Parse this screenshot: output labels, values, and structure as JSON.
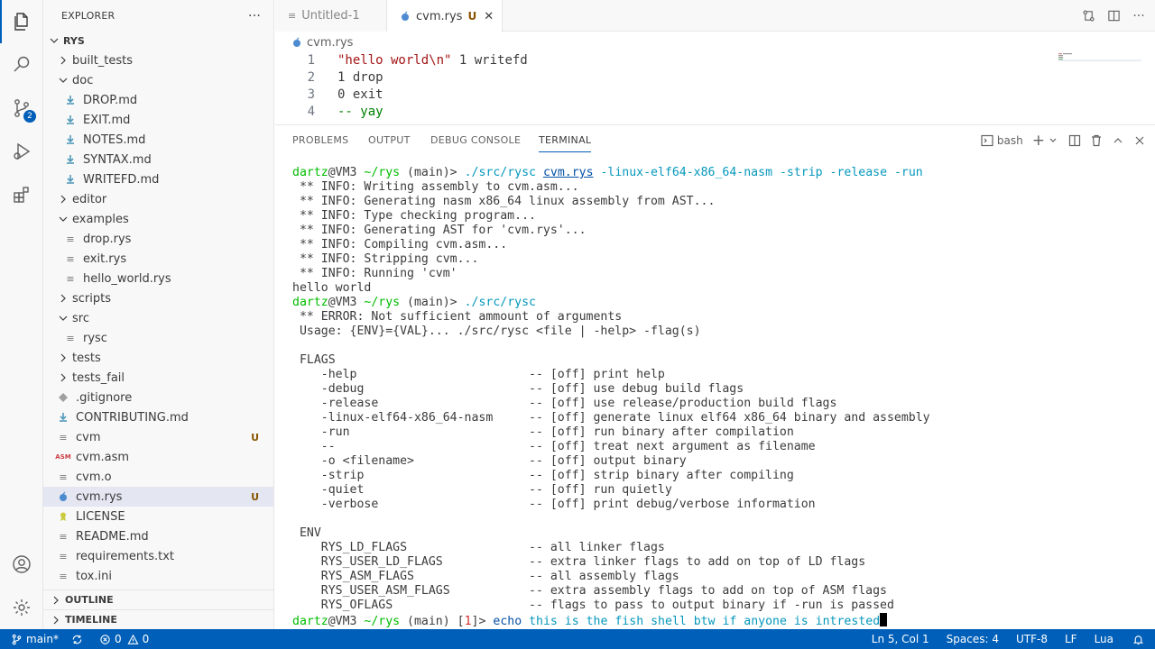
{
  "explorer": {
    "title": "EXPLORER",
    "more": "···",
    "root": "RYS",
    "items": [
      {
        "label": "built_tests",
        "kind": "folder-closed",
        "depth": 1
      },
      {
        "label": "doc",
        "kind": "folder-open",
        "depth": 1
      },
      {
        "label": "DROP.md",
        "kind": "md",
        "depth": 2
      },
      {
        "label": "EXIT.md",
        "kind": "md",
        "depth": 2
      },
      {
        "label": "NOTES.md",
        "kind": "md",
        "depth": 2
      },
      {
        "label": "SYNTAX.md",
        "kind": "md",
        "depth": 2
      },
      {
        "label": "WRITEFD.md",
        "kind": "md",
        "depth": 2
      },
      {
        "label": "editor",
        "kind": "folder-closed",
        "depth": 1
      },
      {
        "label": "examples",
        "kind": "folder-open",
        "depth": 1
      },
      {
        "label": "drop.rys",
        "kind": "file",
        "depth": 2
      },
      {
        "label": "exit.rys",
        "kind": "file",
        "depth": 2
      },
      {
        "label": "hello_world.rys",
        "kind": "file",
        "depth": 2
      },
      {
        "label": "scripts",
        "kind": "folder-closed",
        "depth": 1
      },
      {
        "label": "src",
        "kind": "folder-open",
        "depth": 1
      },
      {
        "label": "rysc",
        "kind": "file",
        "depth": 2
      },
      {
        "label": "tests",
        "kind": "folder-closed",
        "depth": 1
      },
      {
        "label": "tests_fail",
        "kind": "folder-closed",
        "depth": 1
      },
      {
        "label": ".gitignore",
        "kind": "git",
        "depth": 1
      },
      {
        "label": "CONTRIBUTING.md",
        "kind": "md",
        "depth": 1
      },
      {
        "label": "cvm",
        "kind": "file",
        "depth": 1,
        "status": "U"
      },
      {
        "label": "cvm.asm",
        "kind": "asm",
        "depth": 1
      },
      {
        "label": "cvm.o",
        "kind": "file",
        "depth": 1
      },
      {
        "label": "cvm.rys",
        "kind": "rys",
        "depth": 1,
        "status": "U",
        "selected": true
      },
      {
        "label": "LICENSE",
        "kind": "license",
        "depth": 1
      },
      {
        "label": "README.md",
        "kind": "file",
        "depth": 1
      },
      {
        "label": "requirements.txt",
        "kind": "file",
        "depth": 1
      },
      {
        "label": "tox.ini",
        "kind": "file",
        "depth": 1
      }
    ],
    "outline": "OUTLINE",
    "timeline": "TIMELINE"
  },
  "activity": {
    "source_control_badge": "2"
  },
  "tabs": [
    {
      "label": "Untitled-1",
      "active": false
    },
    {
      "label": "cvm.rys",
      "active": true,
      "status": "U",
      "close": "✕"
    }
  ],
  "editor": {
    "breadcrumb": "cvm.rys",
    "lines": [
      {
        "n": "1",
        "tokens": [
          {
            "t": "\"hello world\\n\"",
            "c": "str"
          },
          {
            "t": " 1 writefd",
            "c": "plain"
          }
        ]
      },
      {
        "n": "2",
        "tokens": [
          {
            "t": "1 drop",
            "c": "plain"
          }
        ]
      },
      {
        "n": "3",
        "tokens": [
          {
            "t": "0 exit",
            "c": "plain"
          }
        ]
      },
      {
        "n": "4",
        "tokens": [
          {
            "t": "-- yay",
            "c": "com"
          }
        ]
      }
    ]
  },
  "panel": {
    "tabs": [
      "PROBLEMS",
      "OUTPUT",
      "DEBUG CONSOLE",
      "TERMINAL"
    ],
    "active_tab": "TERMINAL",
    "shell": "bash",
    "plus": "+"
  },
  "terminal": {
    "lines": [
      [
        {
          "t": "dartz",
          "c": "green"
        },
        {
          "t": "@VM3 ",
          "c": "grey"
        },
        {
          "t": "~/rys",
          "c": "green"
        },
        {
          "t": " (main)> ",
          "c": "grey"
        },
        {
          "t": "./src/rysc",
          "c": "cyan"
        },
        {
          "t": " ",
          "c": "grey"
        },
        {
          "t": "cvm.rys",
          "c": "link"
        },
        {
          "t": " -linux-elf64-x86_64-nasm -strip -release -run",
          "c": "cyan"
        }
      ],
      [
        {
          "t": " ** INFO: Writing assembly to cvm.asm...",
          "c": "grey"
        }
      ],
      [
        {
          "t": " ** INFO: Generating nasm x86_64 linux assembly from AST...",
          "c": "grey"
        }
      ],
      [
        {
          "t": " ** INFO: Type checking program...",
          "c": "grey"
        }
      ],
      [
        {
          "t": " ** INFO: Generating AST for 'cvm.rys'...",
          "c": "grey"
        }
      ],
      [
        {
          "t": " ** INFO: Compiling cvm.asm...",
          "c": "grey"
        }
      ],
      [
        {
          "t": " ** INFO: Stripping cvm...",
          "c": "grey"
        }
      ],
      [
        {
          "t": " ** INFO: Running 'cvm'",
          "c": "grey"
        }
      ],
      [
        {
          "t": "hello world",
          "c": "grey"
        }
      ],
      [
        {
          "t": "dartz",
          "c": "green"
        },
        {
          "t": "@VM3 ",
          "c": "grey"
        },
        {
          "t": "~/rys",
          "c": "green"
        },
        {
          "t": " (main)> ",
          "c": "grey"
        },
        {
          "t": "./src/rysc",
          "c": "cyan"
        }
      ],
      [
        {
          "t": " ** ERROR: Not sufficient ammount of arguments",
          "c": "grey"
        }
      ],
      [
        {
          "t": " Usage: {ENV}={VAL}... ./src/rysc <file | -help> -flag(s)",
          "c": "grey"
        }
      ],
      [
        {
          "t": "",
          "c": "grey"
        }
      ],
      [
        {
          "t": " FLAGS",
          "c": "grey"
        }
      ],
      [
        {
          "t": "    -help                        -- [off] print help",
          "c": "grey"
        }
      ],
      [
        {
          "t": "    -debug                       -- [off] use debug build flags",
          "c": "grey"
        }
      ],
      [
        {
          "t": "    -release                     -- [off] use release/production build flags",
          "c": "grey"
        }
      ],
      [
        {
          "t": "    -linux-elf64-x86_64-nasm     -- [off] generate linux elf64 x86_64 binary and assembly",
          "c": "grey"
        }
      ],
      [
        {
          "t": "    -run                         -- [off] run binary after compilation",
          "c": "grey"
        }
      ],
      [
        {
          "t": "    --                           -- [off] treat next argument as filename",
          "c": "grey"
        }
      ],
      [
        {
          "t": "    -o <filename>                -- [off] output binary",
          "c": "grey"
        }
      ],
      [
        {
          "t": "    -strip                       -- [off] strip binary after compiling",
          "c": "grey"
        }
      ],
      [
        {
          "t": "    -quiet                       -- [off] run quietly",
          "c": "grey"
        }
      ],
      [
        {
          "t": "    -verbose                     -- [off] print debug/verbose information",
          "c": "grey"
        }
      ],
      [
        {
          "t": "",
          "c": "grey"
        }
      ],
      [
        {
          "t": " ENV",
          "c": "grey"
        }
      ],
      [
        {
          "t": "    RYS_LD_FLAGS                 -- all linker flags",
          "c": "grey"
        }
      ],
      [
        {
          "t": "    RYS_USER_LD_FLAGS            -- extra linker flags to add on top of LD flags",
          "c": "grey"
        }
      ],
      [
        {
          "t": "    RYS_ASM_FLAGS                -- all assembly flags",
          "c": "grey"
        }
      ],
      [
        {
          "t": "    RYS_USER_ASM_FLAGS           -- extra assembly flags to add on top of ASM flags",
          "c": "grey"
        }
      ],
      [
        {
          "t": "    RYS_OFLAGS                   -- flags to pass to output binary if -run is passed",
          "c": "grey"
        }
      ],
      [
        {
          "t": "dartz",
          "c": "green"
        },
        {
          "t": "@VM3 ",
          "c": "grey"
        },
        {
          "t": "~/rys",
          "c": "green"
        },
        {
          "t": " (main) ",
          "c": "grey"
        },
        {
          "t": "[",
          "c": "grey"
        },
        {
          "t": "1",
          "c": "red"
        },
        {
          "t": "]",
          "c": "grey"
        },
        {
          "t": "> ",
          "c": "grey"
        },
        {
          "t": "echo",
          "c": "blue"
        },
        {
          "t": " this is the fish shell btw if anyone is intrested",
          "c": "cyan"
        }
      ]
    ]
  },
  "status": {
    "branch": "main*",
    "errors": "0",
    "warnings": "0",
    "position": "Ln 5, Col 1",
    "spaces": "Spaces: 4",
    "encoding": "UTF-8",
    "eol": "LF",
    "language": "Lua"
  },
  "colors": {
    "accent": "#005fb8",
    "prompt_green": "#00bc00",
    "cmd_cyan": "#0598bc"
  }
}
